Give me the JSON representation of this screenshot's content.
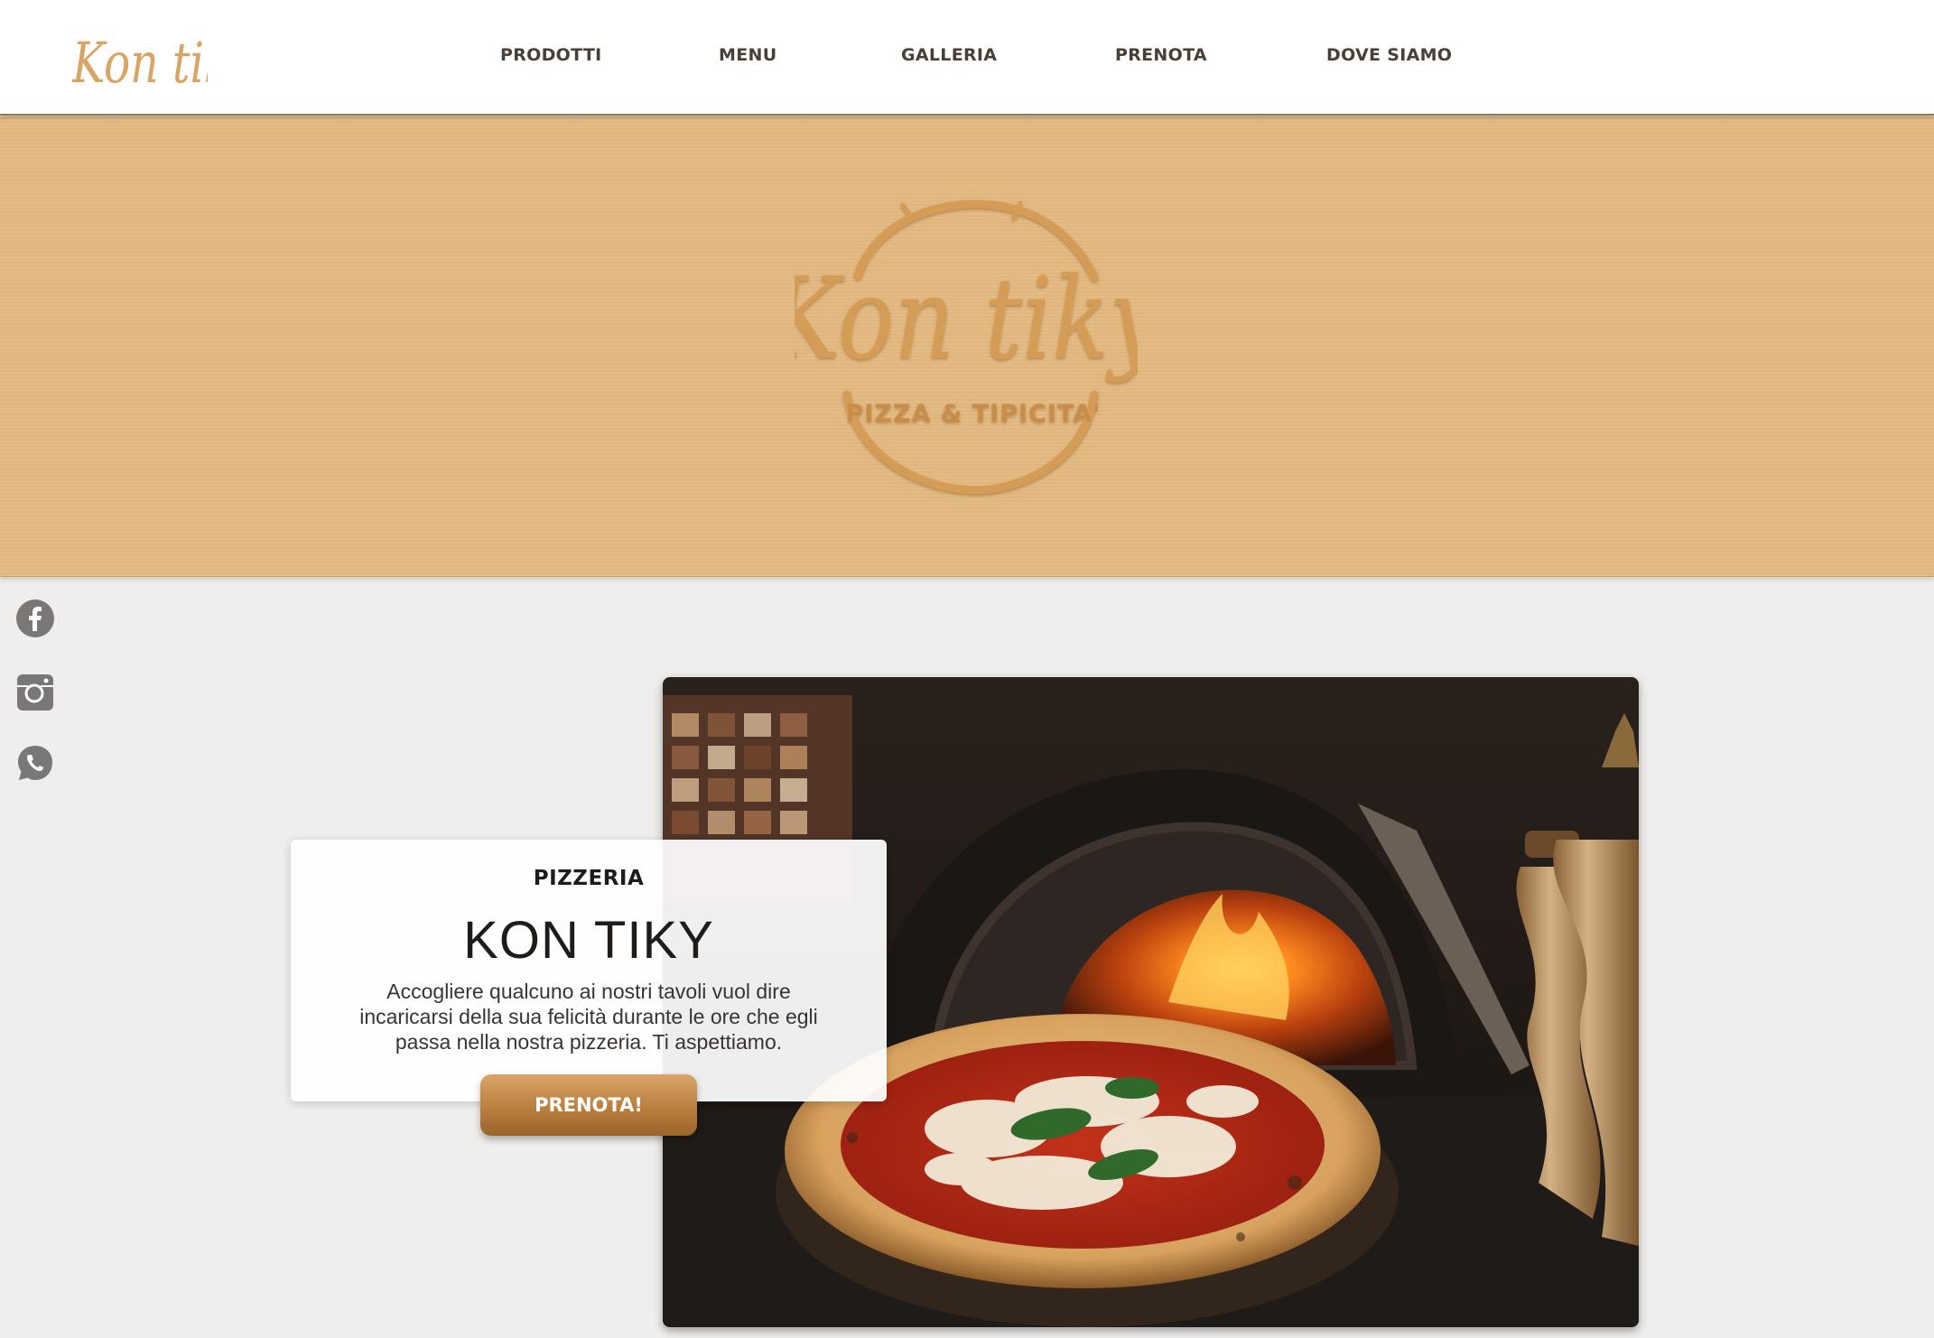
{
  "header": {
    "logo_text": "Kon tiky",
    "nav": [
      {
        "label": "PRODOTTI"
      },
      {
        "label": "MENU"
      },
      {
        "label": "GALLERIA"
      },
      {
        "label": "PRENOTA"
      },
      {
        "label": "DOVE SIAMO"
      }
    ]
  },
  "banner": {
    "logo_title": "Kon tiky",
    "logo_subtitle": "PIZZA & TIPICITA'"
  },
  "social": [
    {
      "icon": "facebook-icon"
    },
    {
      "icon": "instagram-icon"
    },
    {
      "icon": "whatsapp-icon"
    }
  ],
  "hero": {
    "kicker": "PIZZERIA",
    "title": "KON TIKY",
    "text": "Accogliere qualcuno ai nostri tavoli vuol dire incaricarsi della sua felicità durante le ore che egli passa nella nostra pizzeria. Ti aspettiamo.",
    "cta": "PRENOTA!",
    "photo": "pizza-oven-photo"
  },
  "colors": {
    "brand": "#d9a566",
    "banner": "#e3b981",
    "nav_text": "#4a3f36",
    "background": "#efeeec"
  }
}
